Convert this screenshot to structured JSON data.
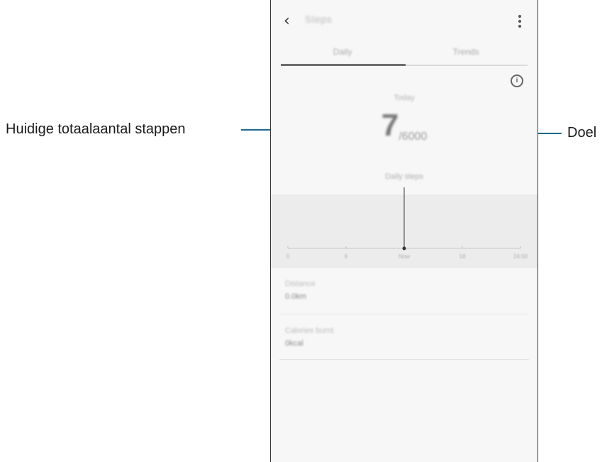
{
  "annotations": {
    "current_total_steps": "Huidige totaalaantal stappen",
    "goal": "Doel"
  },
  "app_bar": {
    "back_icon": "back-arrow-icon",
    "title": "Steps",
    "menu_icon": "more-options-icon"
  },
  "tabs": [
    {
      "label": "Daily",
      "selected": true
    },
    {
      "label": "Trends",
      "selected": false
    }
  ],
  "info_icon": "info-icon",
  "summary": {
    "label": "Today",
    "count": "7",
    "goal": "/6000",
    "subtitle": "Daily steps"
  },
  "chart_data": {
    "type": "bar",
    "x_ticks": [
      "0",
      "6",
      "Now",
      "18",
      "24:00"
    ],
    "xlim": [
      0,
      24
    ],
    "current_hour": 12
  },
  "stats": [
    {
      "label": "Distance",
      "value": "0.0km"
    },
    {
      "label": "Calories burnt",
      "value": "0kcal"
    }
  ],
  "colors": {
    "annotation_line": "#1d6b8c",
    "screen_bg": "#f7f7f7",
    "chart_bg": "#ececec"
  }
}
